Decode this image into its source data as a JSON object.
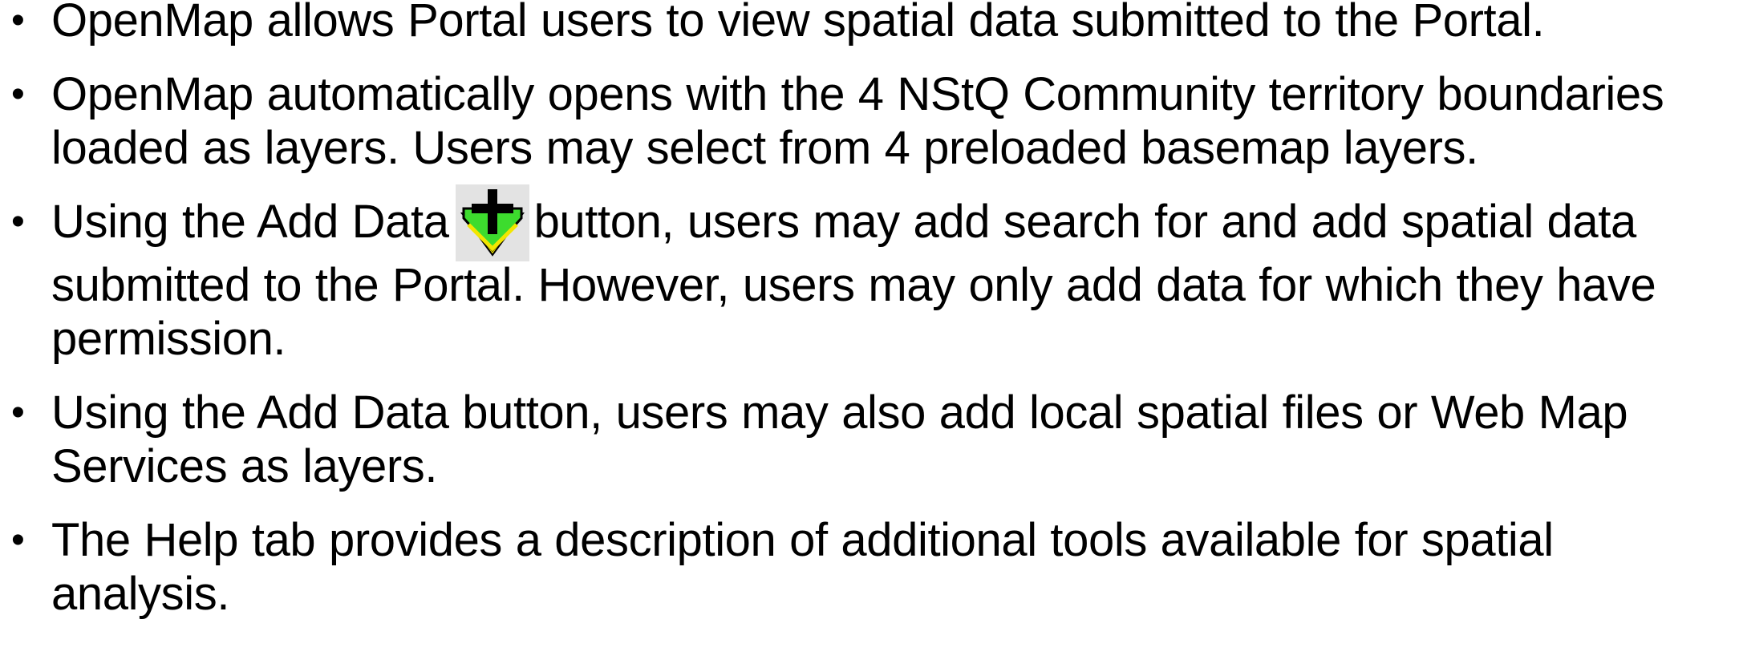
{
  "bullets": [
    {
      "text": "OpenMap allows Portal users to view spatial data submitted to the Portal."
    },
    {
      "text": "OpenMap automatically opens with the 4 NStQ Community territory boundaries loaded as layers. Users may select from 4 preloaded basemap layers."
    },
    {
      "text_before": "Using the Add Data",
      "icon": "add-data-icon",
      "text_after": "button, users may add search for and add spatial data submitted to the Portal. However, users may only add data for which they have permission."
    },
    {
      "text": "Using the Add Data button, users may also add local spatial files or Web Map Services as layers."
    },
    {
      "text": "The Help tab provides a description of additional tools available for spatial analysis."
    }
  ],
  "colors": {
    "text": "#000000",
    "background": "#ffffff",
    "icon_green": "#3ddc2e",
    "icon_yellow": "#f2e600",
    "icon_cross": "#000000",
    "icon_bg": "#e3e3e3"
  }
}
